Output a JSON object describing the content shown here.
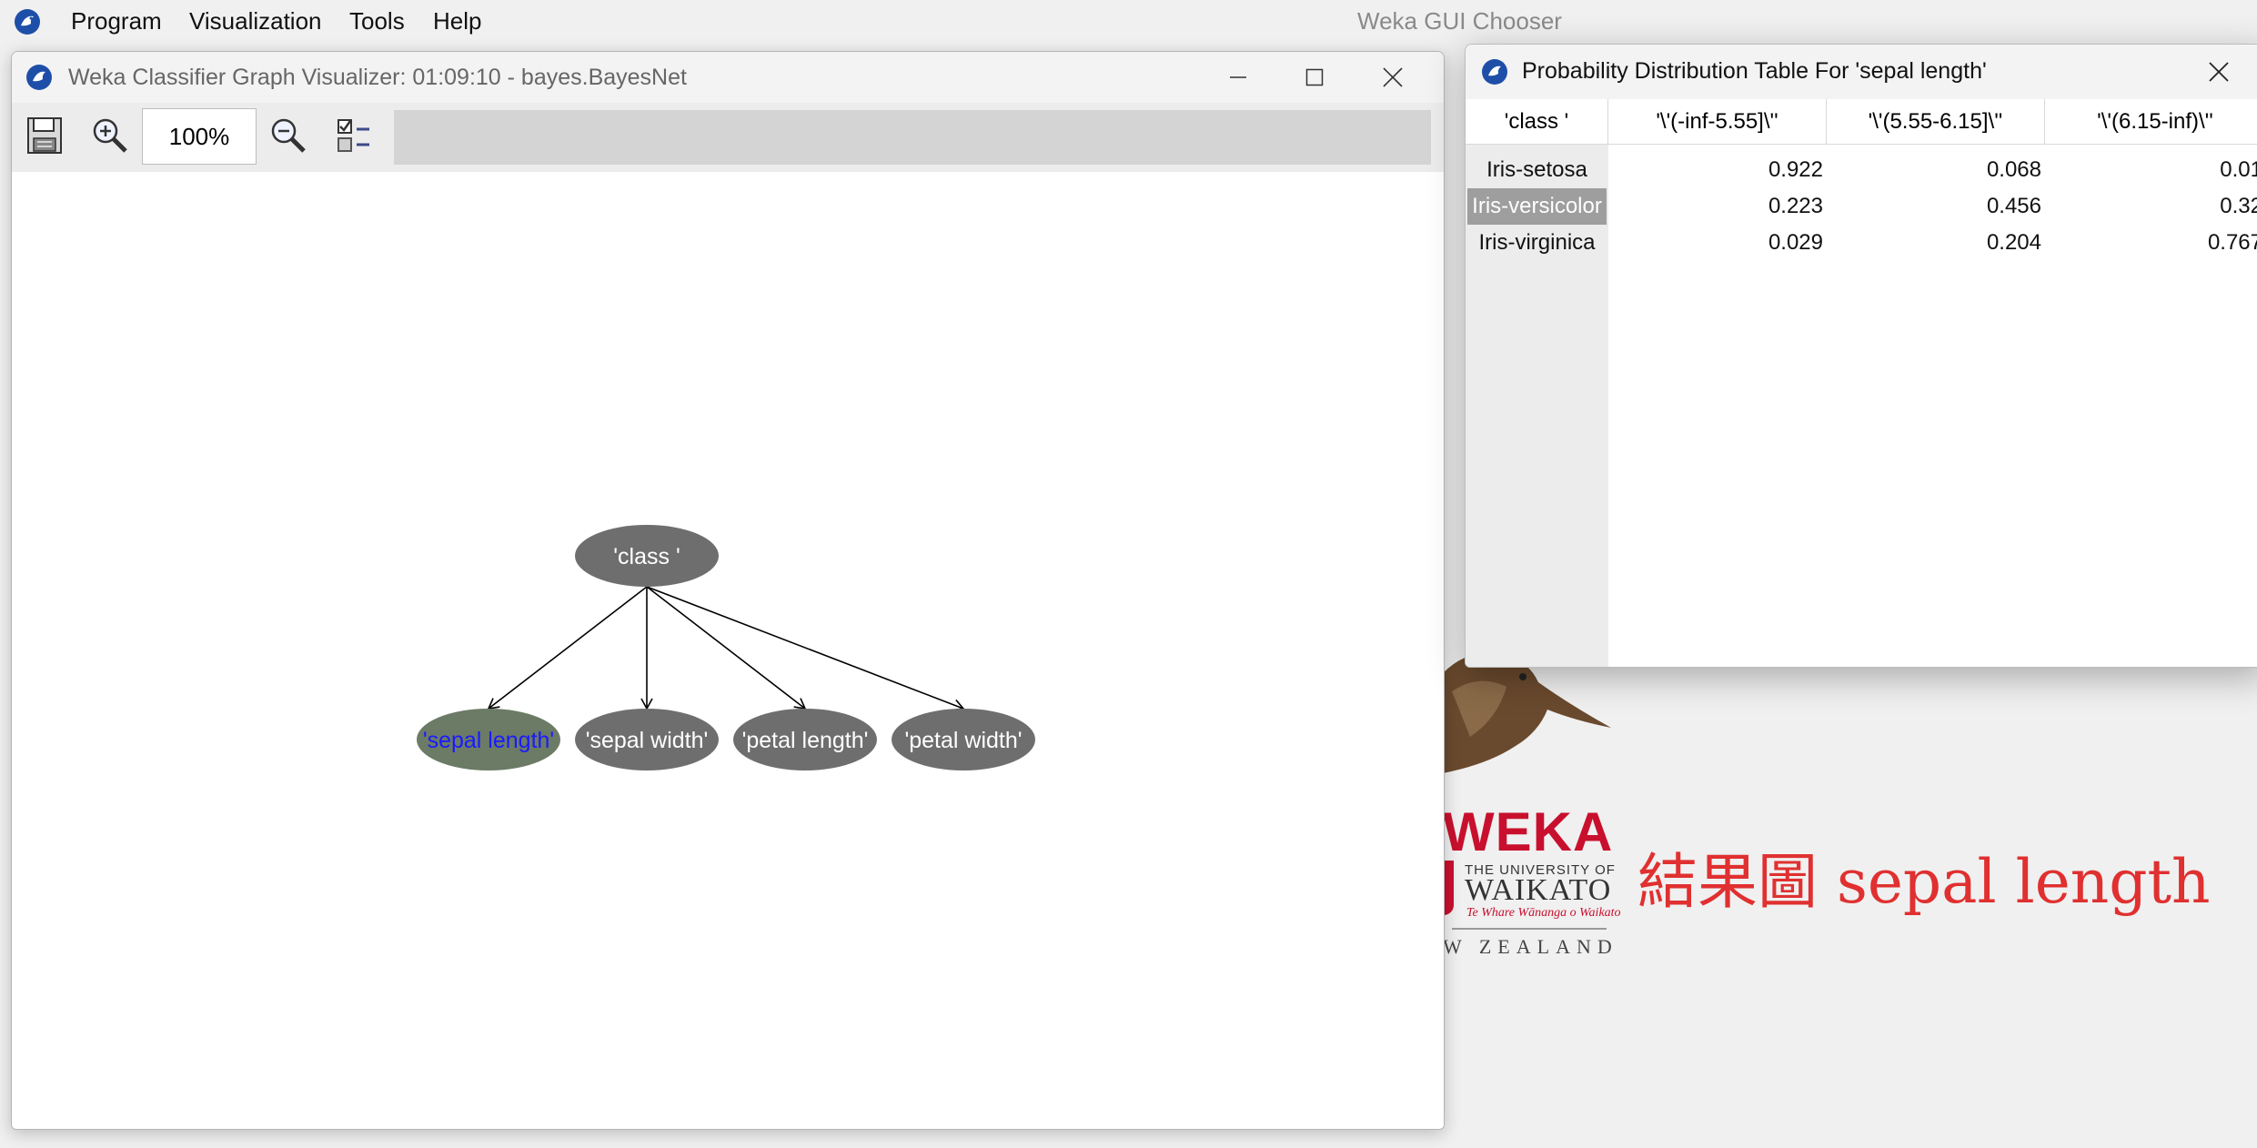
{
  "menubar": {
    "items": [
      "Program",
      "Visualization",
      "Tools",
      "Help"
    ],
    "title": "Weka GUI Chooser"
  },
  "background_logo": {
    "brand": "WEKA",
    "university_line": "THE UNIVERSITY OF",
    "university_name": "WAIKATO",
    "maori_line": "Te Whare Wānanga o Waikato",
    "country": "W ZEALAND",
    "caption": "結果圖 sepal length"
  },
  "graph_window": {
    "title": "Weka Classifier Graph Visualizer: 01:09:10 - bayes.BayesNet",
    "zoom_value": "100%",
    "icons": {
      "save": "save-icon",
      "zoom_in": "zoom-in-icon",
      "zoom_out": "zoom-out-icon",
      "extra": "settings-list-icon",
      "minimize": "minimize-icon",
      "maximize": "maximize-icon",
      "close": "close-icon"
    },
    "nodes": {
      "class": "'class '",
      "sepal_length": "'sepal length'",
      "sepal_width": "'sepal width'",
      "petal_length": "'petal length'",
      "petal_width": "'petal width'"
    },
    "colors": {
      "node_fill": "#6e6e6e",
      "selected_node_fill": "#6b7b66",
      "selected_node_text": "#1a1aff",
      "node_text": "#ffffff"
    }
  },
  "prob_window": {
    "title": "Probability Distribution Table For 'sepal length'",
    "columns": [
      "'class '",
      "'\\'(-inf-5.55]\\''",
      "'\\'(5.55-6.15]\\''",
      "'\\'(6.15-inf)\\''"
    ],
    "rows": [
      {
        "label": "Iris-setosa",
        "values": [
          "0.922",
          "0.068",
          "0.01"
        ],
        "selected": false
      },
      {
        "label": "Iris-versicolor",
        "values": [
          "0.223",
          "0.456",
          "0.32"
        ],
        "selected": true
      },
      {
        "label": "Iris-virginica",
        "values": [
          "0.029",
          "0.204",
          "0.767"
        ],
        "selected": false
      }
    ]
  }
}
